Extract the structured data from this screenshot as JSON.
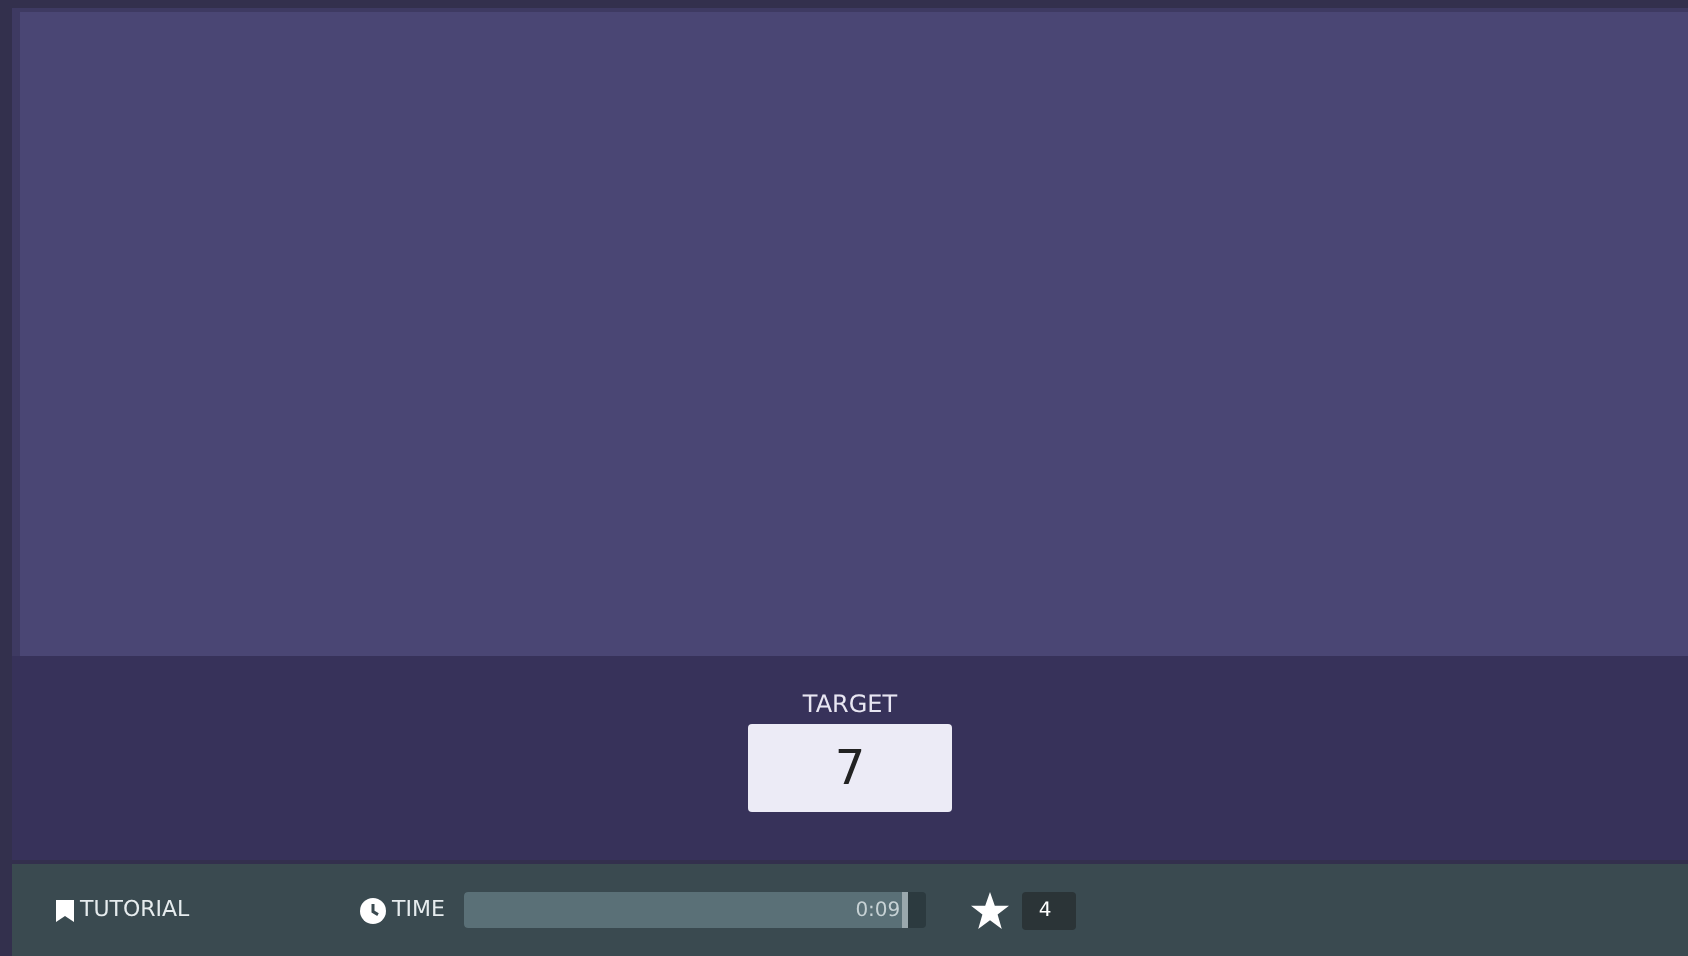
{
  "target": {
    "label": "TARGET",
    "value": "7"
  },
  "footer": {
    "tutorial": "TUTORIAL",
    "time_label": "TIME",
    "timer": {
      "level": 0.96,
      "reading": "0:09"
    },
    "score": "4"
  }
}
